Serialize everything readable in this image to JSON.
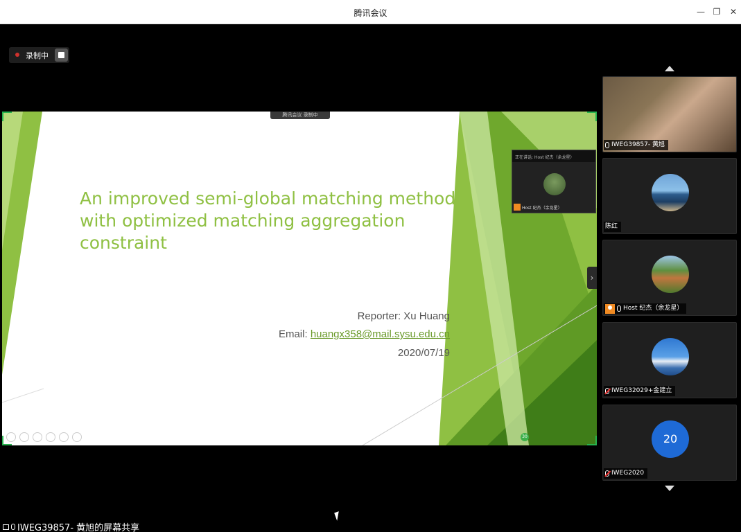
{
  "window": {
    "title": "腾讯会议",
    "minimize_icon": "minimize-icon",
    "restore_icon": "restore-icon",
    "close_icon": "close-icon"
  },
  "recording": {
    "label": "录制中"
  },
  "slide": {
    "title": "An improved semi-global matching method with optimized matching aggregation constraint",
    "reporter": "Reporter: Xu Huang",
    "email_label": "Email: ",
    "email": "huangx358@mail.sysu.edu.cn",
    "date": "2020/07/19",
    "page_badge": "30",
    "share_tag": "腾讯会议  录制中",
    "mini_tile_top": "正在讲话: Host 纪杰（余龙星）",
    "mini_tile_name": "Host 纪杰（余龙星）",
    "accent_color": "#8fc043"
  },
  "participants": [
    {
      "name": "IWEG39857- 黄旭",
      "muted": false,
      "host": false,
      "avatar": "camera"
    },
    {
      "name": "陈红",
      "muted": false,
      "host": false,
      "avatar": "sea-photo"
    },
    {
      "name": "Host 纪杰（余龙星）",
      "muted": false,
      "host": true,
      "avatar": "garden-photo"
    },
    {
      "name": "IWEG32029+金建立",
      "muted": true,
      "host": false,
      "avatar": "mountain-photo"
    },
    {
      "name": "IWEG2020",
      "muted": true,
      "host": false,
      "avatar": "number",
      "avatar_text": "20"
    }
  ],
  "status": {
    "share_label": "IWEG39857- 黄旭的屏幕共享"
  }
}
